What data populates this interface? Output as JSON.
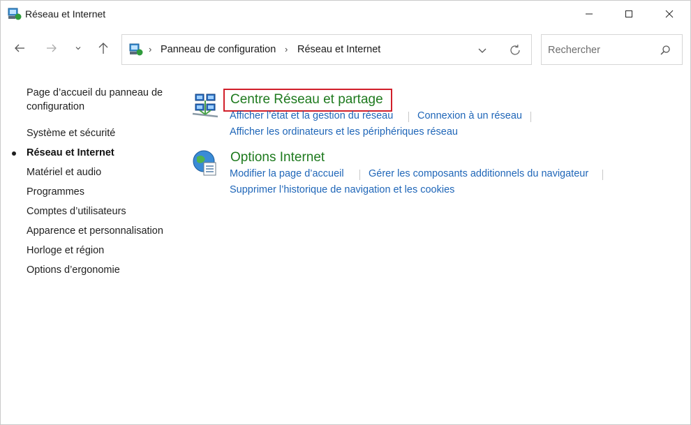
{
  "window": {
    "title": "Réseau et Internet"
  },
  "navigation": {
    "breadcrumb": [
      "Panneau de configuration",
      "Réseau et Internet"
    ],
    "search_placeholder": "Rechercher"
  },
  "sidebar": {
    "items": [
      {
        "label": "Page d’accueil du panneau de",
        "label2": "configuration"
      },
      {
        "label": "Système et sécurité"
      },
      {
        "label": "Réseau et Internet",
        "active": true
      },
      {
        "label": "Matériel et audio"
      },
      {
        "label": "Programmes"
      },
      {
        "label": "Comptes d’utilisateurs"
      },
      {
        "label": "Apparence et personnalisation"
      },
      {
        "label": "Horloge et région"
      },
      {
        "label": "Options d’ergonomie"
      }
    ]
  },
  "categories": [
    {
      "title": "Centre Réseau et partage",
      "highlighted": true,
      "icon": "network-sharing-icon",
      "links": [
        "Afficher l’état et la gestion du réseau",
        "Connexion à un réseau",
        "Afficher les ordinateurs et les périphériques réseau"
      ]
    },
    {
      "title": "Options Internet",
      "highlighted": false,
      "icon": "internet-options-icon",
      "links": [
        "Modifier la page d’accueil",
        "Gérer les composants additionnels du navigateur",
        "Supprimer l’historique de navigation et les cookies"
      ]
    }
  ],
  "colors": {
    "category_title": "#1e7a1e",
    "link": "#1f66b8",
    "highlight_border": "#d11f2a"
  }
}
